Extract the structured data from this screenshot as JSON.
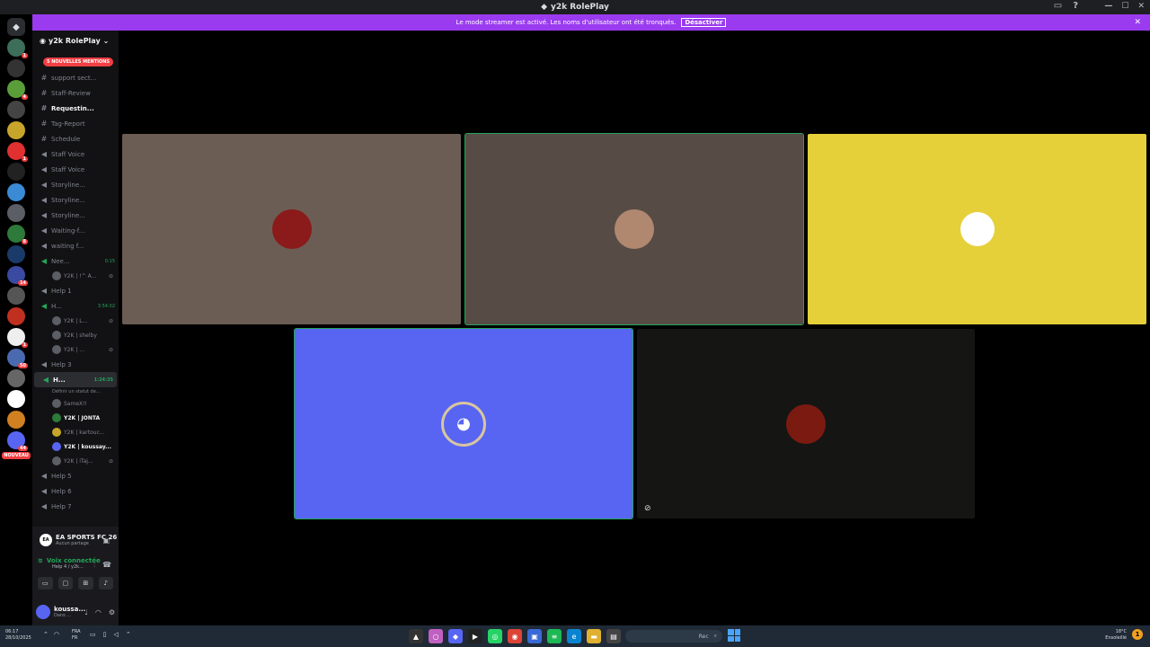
{
  "window": {
    "title": "y2k RolePlay"
  },
  "banner": {
    "text": "Le mode streamer est activé. Les noms d'utilisateur ont été tronqués.",
    "button": "Désactiver"
  },
  "server": {
    "name": "y2k RolePlay",
    "mentions": "5 NOUVELLES MENTIONS"
  },
  "channels": [
    {
      "name": "support sect...",
      "type": "text"
    },
    {
      "name": "Staff-Review",
      "type": "text"
    },
    {
      "name": "Requestin...",
      "type": "text",
      "bright": true
    },
    {
      "name": "Tag-Report",
      "type": "text"
    },
    {
      "name": "Schedule",
      "type": "text"
    },
    {
      "name": "Staff Voice",
      "type": "voice"
    },
    {
      "name": "Staff Voice",
      "type": "voice"
    },
    {
      "name": "Storyline...",
      "type": "voice"
    },
    {
      "name": "Storyline...",
      "type": "voice"
    },
    {
      "name": "Storyline...",
      "type": "voice"
    },
    {
      "name": "Waiting-f...",
      "type": "voice"
    },
    {
      "name": "waiting f...",
      "type": "voice"
    },
    {
      "name": "Nee...",
      "type": "voice",
      "timer": "0:15"
    }
  ],
  "users_need": [
    {
      "name": "Y2K | !^ A..."
    }
  ],
  "channels2": [
    {
      "name": "Help 1"
    },
    {
      "name": "H...",
      "timer": "3:54:02"
    }
  ],
  "users_h2": [
    {
      "name": "Y2K | L..."
    },
    {
      "name": "Y2K | shelby"
    },
    {
      "name": "Y2K | ..."
    }
  ],
  "channels3": [
    {
      "name": "Help 3"
    },
    {
      "name": "H...",
      "timer": "1:24:35",
      "bright": true,
      "status": "Définir un statut de..."
    }
  ],
  "users_h4": [
    {
      "name": "SameX!!"
    },
    {
      "name": "Y2K | JONTA",
      "bright": true
    },
    {
      "name": "Y2K | kartouc..."
    },
    {
      "name": "Y2K | koussay...",
      "bright": true
    },
    {
      "name": "Y2K | iTaj..."
    }
  ],
  "channels4": [
    {
      "name": "Help 5"
    },
    {
      "name": "Help 6"
    },
    {
      "name": "Help 7"
    }
  ],
  "activity": {
    "title": "EA SPORTS FC 26",
    "subtitle": "Aucun partage",
    "icon": "EA"
  },
  "voice": {
    "status": "Voix connectée",
    "location": "Help 4 / y2k..."
  },
  "user": {
    "name": "koussa...",
    "status": "Dans ..."
  },
  "tiles": [
    {
      "color": "#6b5d53",
      "avatar_bg": "#8b1a1a"
    },
    {
      "color": "#574b45",
      "avatar_bg": "#b08870",
      "speaking": true
    },
    {
      "color": "#e5d03a",
      "avatar_bg": "#ffffff"
    },
    {
      "color": "#5865f2",
      "avatar_bg": "#5865f2",
      "speaking": true
    },
    {
      "color": "#151513",
      "avatar_bg": "#7a1a10",
      "muted": true
    }
  ],
  "taskbar": {
    "time": "06:17",
    "date": "28/10/2025",
    "lang1": "FRA",
    "lang2": "FR",
    "search": "Rec",
    "weather1": "18°C",
    "weather2": "Ensoleillé",
    "notif": "1"
  },
  "guild_badges": [
    "1",
    "4",
    "1",
    "8",
    "14",
    "1",
    "50",
    "44"
  ],
  "guild_new": "NOUVEAU",
  "colors": {
    "accent": "#9b3bf0",
    "speaking": "#23a55a",
    "blurple": "#5865f2"
  }
}
